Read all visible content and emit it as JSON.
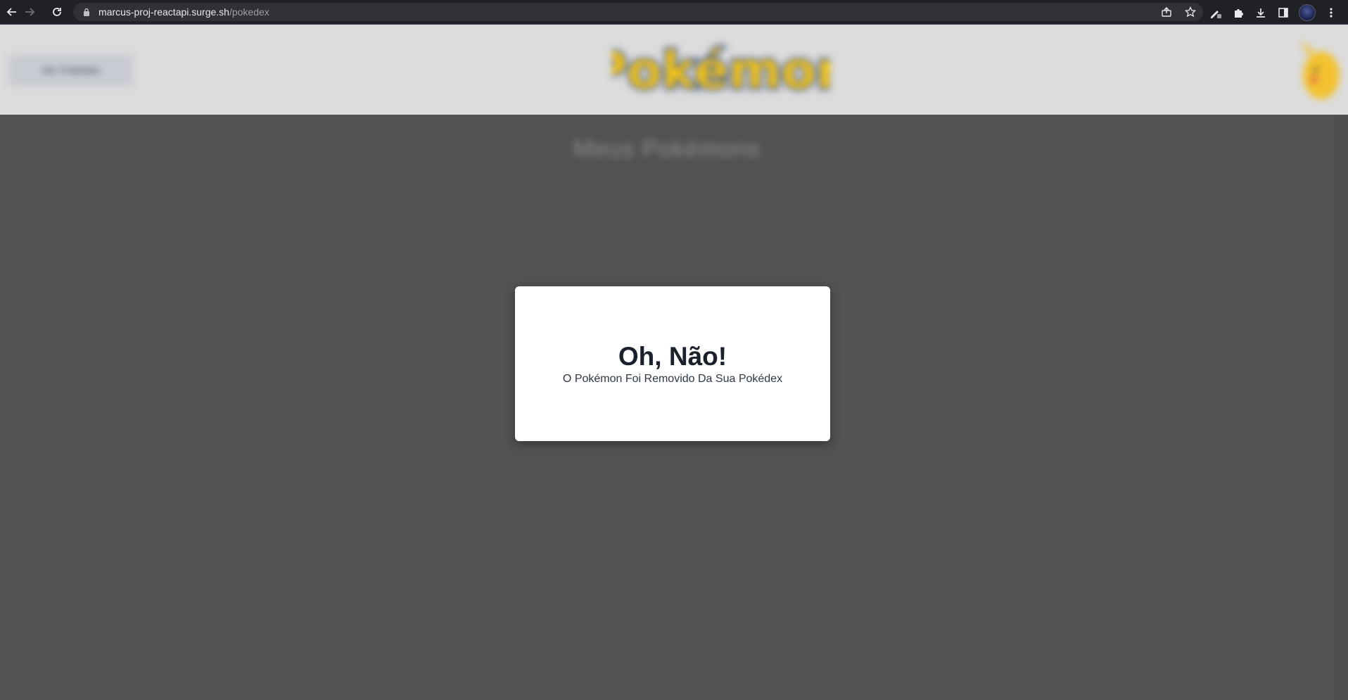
{
  "browser": {
    "url_host": "marcus-proj-reactapi.surge.sh",
    "url_path": "/pokedex",
    "icons": {
      "back": "back-arrow-icon",
      "forward": "forward-arrow-icon",
      "reload": "reload-icon",
      "lock": "lock-icon",
      "share": "share-icon",
      "bookmark": "star-icon",
      "extension_pen": "pen-icon",
      "extensions": "puzzle-icon",
      "downloads": "download-icon",
      "side_panel": "side-panel-icon",
      "menu": "kebab-menu-icon"
    }
  },
  "header": {
    "button_label": "Ver Pokédex",
    "logo": "Pokémon"
  },
  "main": {
    "title": "Meus Pokémons"
  },
  "modal": {
    "title": "Oh, Não!",
    "message": "O Pokémon Foi Removido Da Sua Pokédex"
  },
  "colors": {
    "overlay": "#4f4f4f",
    "header_bg": "#dcdcdc",
    "modal_bg": "#ffffff",
    "modal_title": "#1a202c",
    "logo_yellow": "#f5c518",
    "logo_blue": "#2f4f9a"
  }
}
